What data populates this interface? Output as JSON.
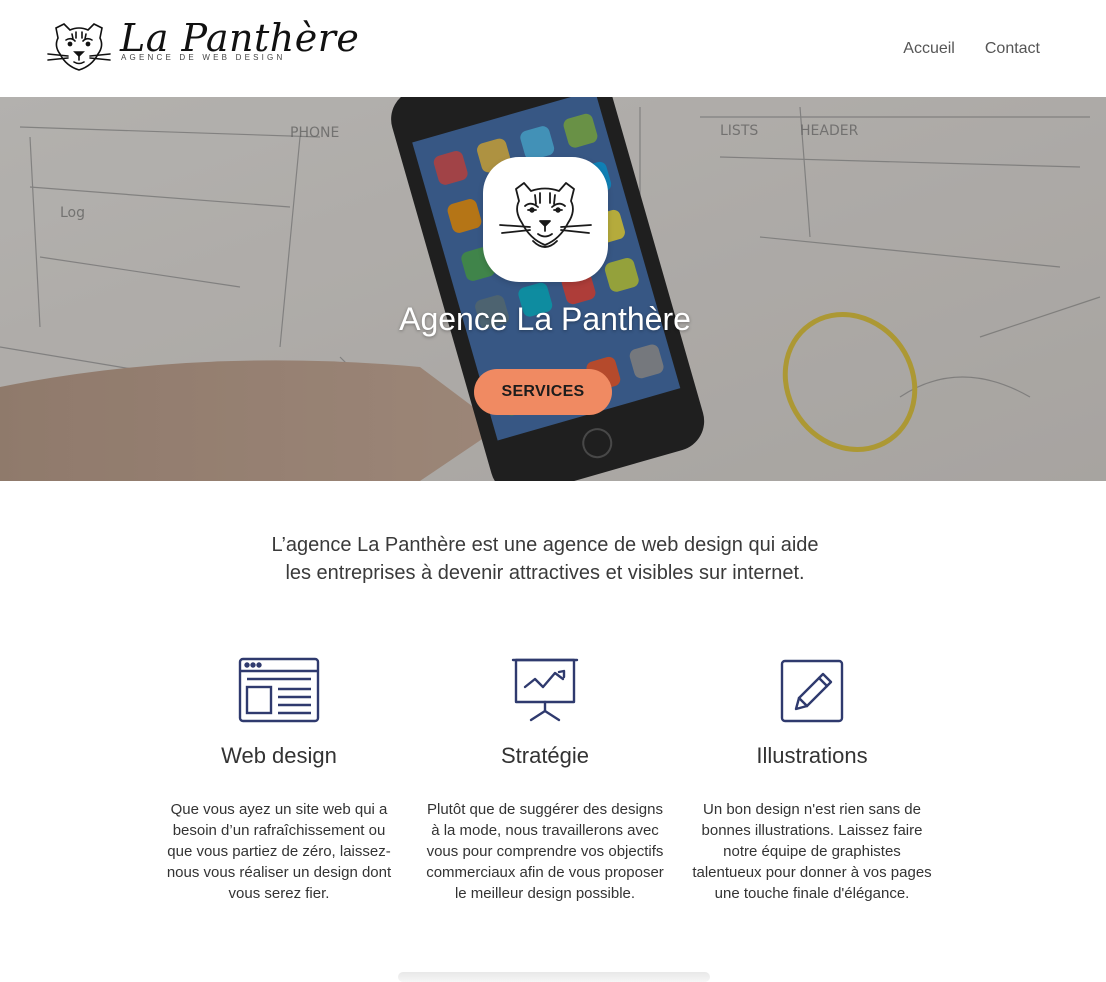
{
  "header": {
    "logo": {
      "name": "La Panthère",
      "tagline": "AGENCE DE WEB DESIGN"
    },
    "nav": [
      {
        "label": "Accueil"
      },
      {
        "label": "Contact"
      }
    ]
  },
  "hero": {
    "title": "Agence La Panthère",
    "cta_label": "SERVICES",
    "cta_color": "#f08a62"
  },
  "intro": {
    "line1": "L’agence La Panthère est une agence de web design qui aide",
    "line2": "les entreprises à devenir attractives et visibles sur internet."
  },
  "services": [
    {
      "icon": "web-layout-icon",
      "title": "Web design",
      "text": "Que vous ayez un site web qui a besoin d’un rafraîchissement ou que vous partiez de zéro, laissez-nous vous réaliser un design dont vous serez fier."
    },
    {
      "icon": "presentation-chart-icon",
      "title": "Stratégie",
      "text": "Plutôt que de suggérer des designs à la mode, nous travaillerons avec vous pour comprendre vos objectifs commerciaux afin de vous proposer le meilleur design possible."
    },
    {
      "icon": "pencil-edit-icon",
      "title": "Illustrations",
      "text": "Un bon design n'est rien sans de bonnes illustrations. Laissez faire notre équipe de graphistes talentueux pour donner à vos pages une touche finale d'élégance."
    }
  ],
  "colors": {
    "icon": "#2f3a6e",
    "accent": "#f08a62"
  }
}
